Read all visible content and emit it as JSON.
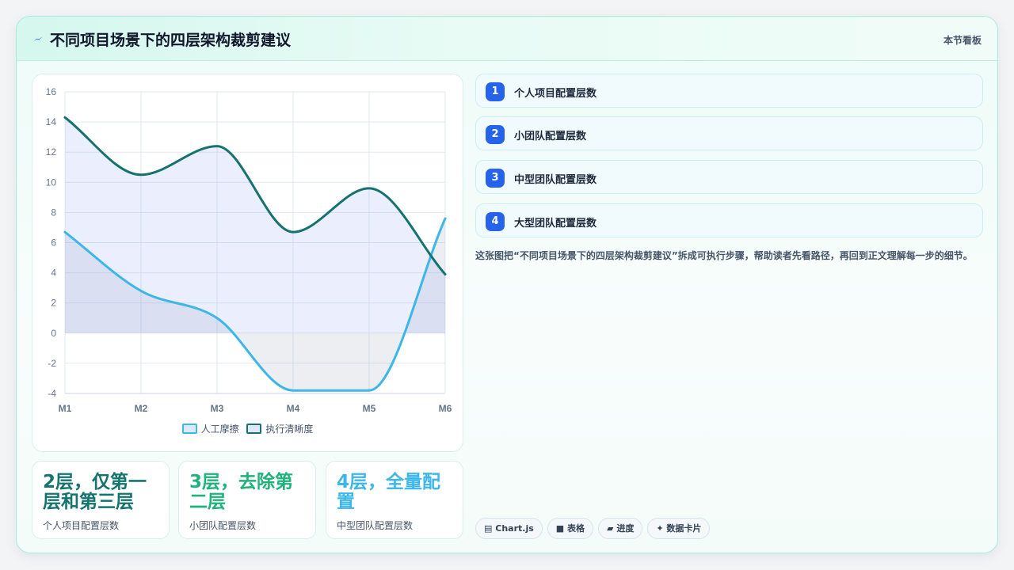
{
  "header": {
    "icon": "lightning-icon",
    "title": "不同项目场景下的四层架构裁剪建议",
    "right_label": "本节看板"
  },
  "chart_data": {
    "type": "line",
    "categories": [
      "M1",
      "M2",
      "M3",
      "M4",
      "M5",
      "M6"
    ],
    "series": [
      {
        "name": "人工摩擦",
        "values": [
          6.7,
          2.8,
          1.0,
          -3.8,
          -3.8,
          7.6
        ],
        "color": "#3db6e8"
      },
      {
        "name": "执行清晰度",
        "values": [
          14.3,
          10.5,
          12.4,
          6.7,
          9.6,
          3.9
        ],
        "color": "#15736e"
      }
    ],
    "ylim": [
      -4,
      16
    ],
    "yticks": [
      16,
      14,
      12,
      10,
      8,
      6,
      4,
      2,
      0,
      -2,
      -4
    ],
    "grid": true,
    "legend": "bottom",
    "smooth": true,
    "fill": true
  },
  "stats": [
    {
      "value": "2层，仅第一层和第三层",
      "label": "个人项目配置层数",
      "color": "#15736e"
    },
    {
      "value": "3层，去除第二层",
      "label": "小团队配置层数",
      "color": "#1fb27a"
    },
    {
      "value": "4层，全量配置",
      "label": "中型团队配置层数",
      "color": "#3db6e8"
    }
  ],
  "steps": [
    {
      "num": "1",
      "label": "个人项目配置层数"
    },
    {
      "num": "2",
      "label": "小团队配置层数"
    },
    {
      "num": "3",
      "label": "中型团队配置层数"
    },
    {
      "num": "4",
      "label": "大型团队配置层数"
    }
  ],
  "description": "这张图把“不同项目场景下的四层架构裁剪建议”拆成可执行步骤，帮助读者先看路径，再回到正文理解每一步的细节。",
  "chips": [
    {
      "icon": "chart-icon",
      "glyph": "▤",
      "label": "Chart.js"
    },
    {
      "icon": "table-icon",
      "glyph": "■",
      "label": "表格"
    },
    {
      "icon": "progress-icon",
      "glyph": "▰",
      "label": "进度"
    },
    {
      "icon": "sparkle-icon",
      "glyph": "✦",
      "label": "数据卡片"
    }
  ]
}
